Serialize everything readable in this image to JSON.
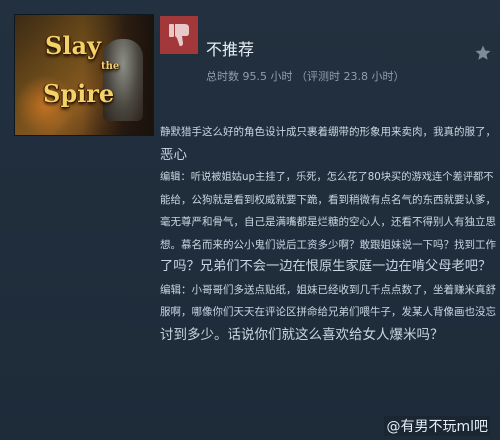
{
  "game": {
    "title_line1": "Slay",
    "title_the": "the",
    "title_line2": "Spire"
  },
  "review": {
    "verdict": "不推荐",
    "hours": "总时数 95.5 小时 （评测时 23.8 小时）",
    "lines": [
      "静默猎手这么好的角色设计成只裹着绷带的形象用来卖肉，我真的服了，",
      "恶心",
      "编辑：听说被姐姑up主挂了，乐死，怎么花了80块买的游戏连个差评都不",
      "能给，公狗就是看到权威就要下跪，看到稍微有点名气的东西就要认爹，",
      "毫无尊严和骨气，自己是满嘴都是烂糖的空心人，还看不得别人有独立思",
      "想。慕名而来的公小鬼们说后工资多少啊？敢跟姐妹说一下吗？找到工作",
      "了吗？兄弟们不会一边在恨原生家庭一边在啃父母老吧？",
      "编辑：小哥哥们多送点贴纸，姐妹已经收到几千点点数了，坐着赚米真舒",
      "服啊，哪像你们天天在评论区拼命给兄弟们喂牛子，发某人背像画也没忘",
      "讨到多少。话说你们就这么喜欢给女人爆米吗？"
    ]
  },
  "watermark": "@有男不玩ml吧",
  "colors": {
    "thumb_bg": "#a3383b",
    "background": "#1e2b39"
  },
  "icons": [
    "thumbs-down-icon",
    "star-icon"
  ]
}
